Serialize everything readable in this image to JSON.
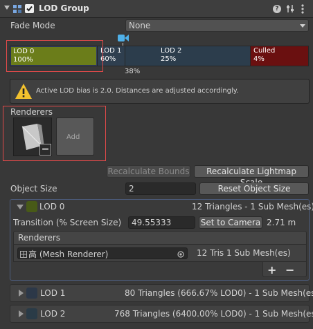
{
  "header": {
    "title": "LOD Group",
    "help_icon": "help-icon",
    "presets_icon": "sliders-icon",
    "menu_icon": "kebab-menu-icon",
    "component_icon": "lod-group-icon"
  },
  "fade_mode": {
    "label": "Fade Mode",
    "value": "None"
  },
  "lod_bar": {
    "segments": [
      {
        "name": "LOD 0",
        "percent": "100%",
        "color": "#6b7d1a"
      },
      {
        "name": "LOD 1",
        "percent": "60%",
        "color": "#2f3f4f"
      },
      {
        "name": "LOD 2",
        "percent": "25%",
        "color": "#2c3d4c"
      },
      {
        "name": "Culled",
        "percent": "4%",
        "color": "#6a1010"
      }
    ],
    "camera_marker": "38%"
  },
  "warning": {
    "text": "Active LOD bias is 2.0. Distances are adjusted accordingly."
  },
  "renderers": {
    "label": "Renderers",
    "add_label": "Add",
    "remove_label": "−"
  },
  "buttons": {
    "recalc_bounds": "Recalculate Bounds",
    "recalc_lightmap": "Recalculate Lightmap Scale"
  },
  "object_size": {
    "label": "Object Size",
    "value": "2",
    "reset_label": "Reset Object Size"
  },
  "lod0": {
    "title": "LOD 0",
    "summary": "12 Triangles  - 1 Sub Mesh(es)",
    "transition_label": "Transition (% Screen Size)",
    "transition_value": "49.55333",
    "set_camera_label": "Set to Camera",
    "distance": "2.71 m",
    "renderers_label": "Renderers",
    "renderer_name": "高 (Mesh Renderer)",
    "renderer_info": "12 Tris  1 Sub Mesh(es)",
    "plus": "+",
    "minus": "−"
  },
  "lod1": {
    "title": "LOD 1",
    "summary": "80 Triangles (666.67% LOD0) - 1 Sub Mesh(es)"
  },
  "lod2": {
    "title": "LOD 2",
    "summary": "768 Triangles (6400.00% LOD0) - 1 Sub Mesh(es)"
  }
}
